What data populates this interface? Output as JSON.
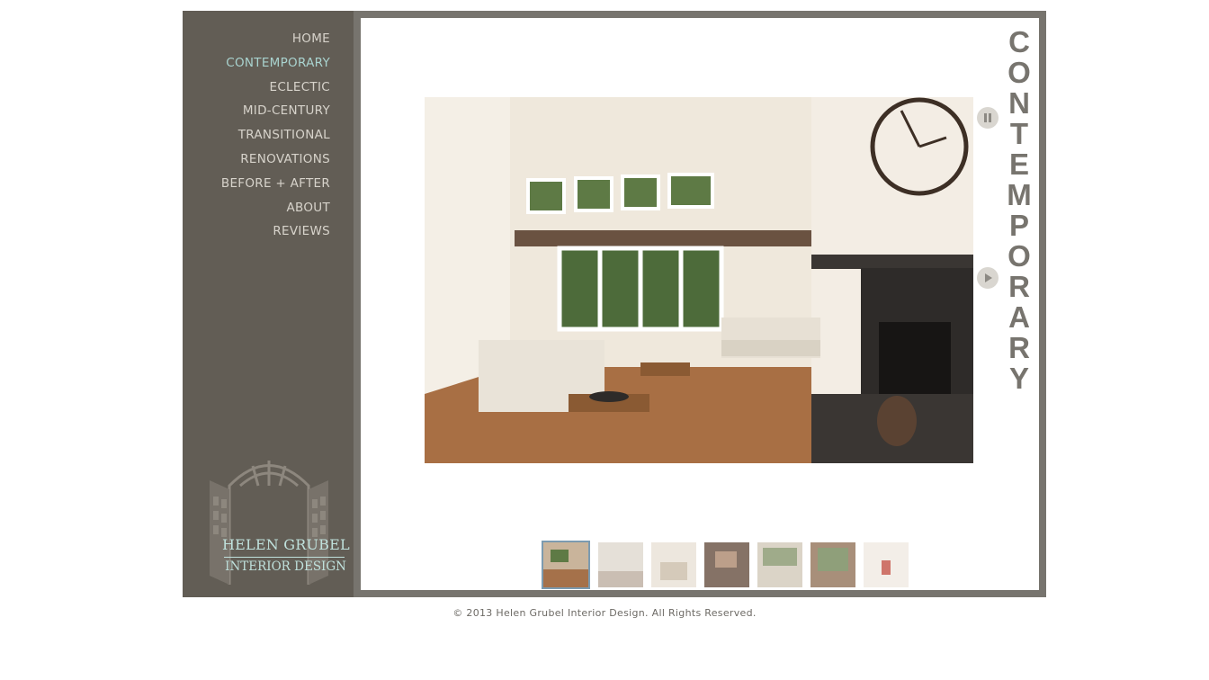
{
  "nav": {
    "items": [
      {
        "label": "HOME"
      },
      {
        "label": "CONTEMPORARY",
        "active": true
      },
      {
        "label": "ECLECTIC"
      },
      {
        "label": "MID-CENTURY"
      },
      {
        "label": "TRANSITIONAL"
      },
      {
        "label": "RENOVATIONS"
      },
      {
        "label": "BEFORE + AFTER"
      },
      {
        "label": "ABOUT"
      },
      {
        "label": "REVIEWS"
      }
    ]
  },
  "logo": {
    "name": "HELEN GRUBEL",
    "subtitle": "INTERIOR DESIGN"
  },
  "section": {
    "title": "CONTEMPORARY"
  },
  "slideshow": {
    "pause_icon": "pause-icon",
    "play_icon": "play-icon",
    "thumbnail_count": 7,
    "active_thumbnail": 1
  },
  "footer": {
    "copyright": "© 2013 Helen Grubel Interior Design. All Rights Reserved."
  },
  "colors": {
    "sidebar_bg": "#625d55",
    "frame": "#77746e",
    "nav_text": "#d7d3cb",
    "nav_active": "#a9d3cf",
    "logo_text": "#bfe1dc"
  }
}
